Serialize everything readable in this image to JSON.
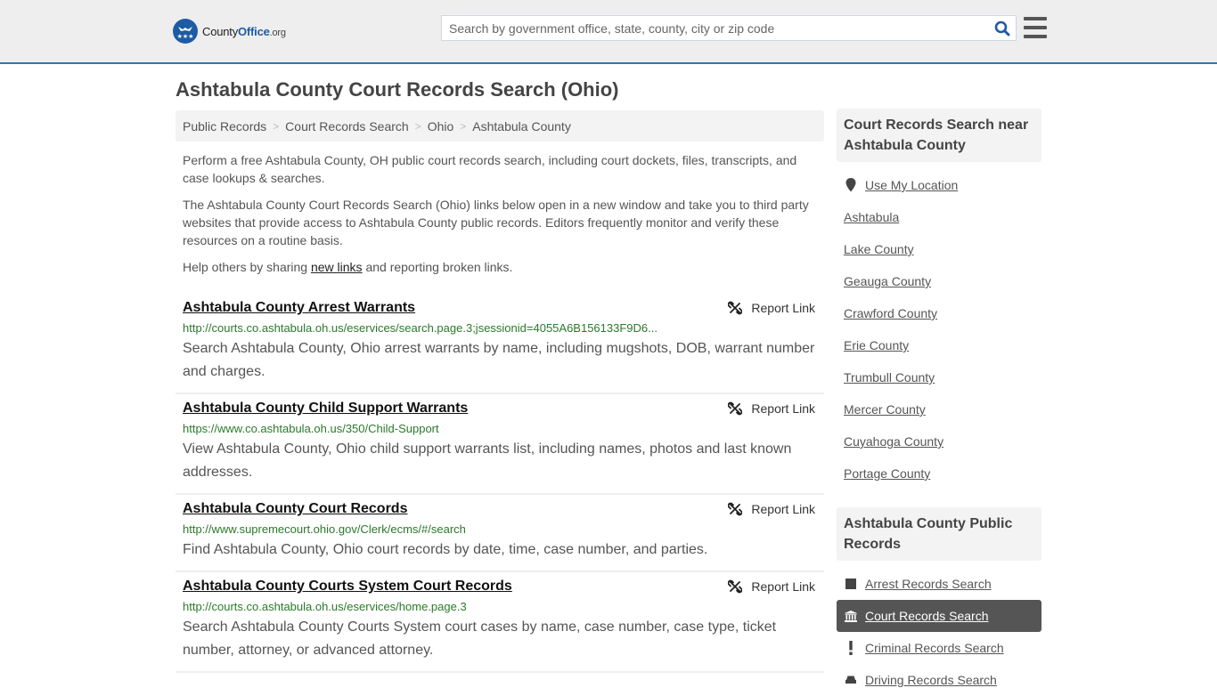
{
  "header": {
    "logo": {
      "prefix": "County",
      "brand": "Office",
      "tld": ".org"
    },
    "search_placeholder": "Search by government office, state, county, city or zip code",
    "search_value": ""
  },
  "page_title": "Ashtabula County Court Records Search (Ohio)",
  "breadcrumb": [
    "Public Records",
    "Court Records Search",
    "Ohio",
    "Ashtabula County"
  ],
  "intro": {
    "p1": "Perform a free Ashtabula County, OH public court records search, including court dockets, files, transcripts, and case lookups & searches.",
    "p2": "The Ashtabula County Court Records Search (Ohio) links below open in a new window and take you to third party websites that provide access to Ashtabula County public records. Editors frequently monitor and verify these resources on a routine basis.",
    "p3_before": "Help others by sharing ",
    "p3_link": "new links",
    "p3_after": " and reporting broken links."
  },
  "report_label": "Report Link",
  "results": [
    {
      "title": "Ashtabula County Arrest Warrants",
      "url": "http://courts.co.ashtabula.oh.us/eservices/search.page.3;jsessionid=4055A6B156133F9D6...",
      "desc": "Search Ashtabula County, Ohio arrest warrants by name, including mugshots, DOB, warrant number and charges."
    },
    {
      "title": "Ashtabula County Child Support Warrants",
      "url": "https://www.co.ashtabula.oh.us/350/Child-Support",
      "desc": "View Ashtabula County, Ohio child support warrants list, including names, photos and last known addresses."
    },
    {
      "title": "Ashtabula County Court Records",
      "url": "http://www.supremecourt.ohio.gov/Clerk/ecms/#/search",
      "desc": "Find Ashtabula County, Ohio court records by date, time, case number, and parties."
    },
    {
      "title": "Ashtabula County Courts System Court Records",
      "url": "http://courts.co.ashtabula.oh.us/eservices/home.page.3",
      "desc": "Search Ashtabula County Courts System court cases by name, case number, case type, ticket number, attorney, or advanced attorney."
    }
  ],
  "sidebar": {
    "nearby_title": "Court Records Search near Ashtabula County",
    "use_location": "Use My Location",
    "nearby": [
      "Ashtabula",
      "Lake County",
      "Geauga County",
      "Crawford County",
      "Erie County",
      "Trumbull County",
      "Mercer County",
      "Cuyahoga County",
      "Portage County"
    ],
    "public_title": "Ashtabula County Public Records",
    "public": [
      {
        "label": "Arrest Records Search",
        "icon": "square-icon",
        "active": false
      },
      {
        "label": "Court Records Search",
        "icon": "courthouse-icon",
        "active": true
      },
      {
        "label": "Criminal Records Search",
        "icon": "exclamation-icon",
        "active": false
      },
      {
        "label": "Driving Records Search",
        "icon": "car-icon",
        "active": false
      }
    ]
  },
  "colors": {
    "accent": "#2f77b1",
    "brand": "#1e5ba5",
    "url_green": "#2a7a2a",
    "active_bg": "#555555"
  }
}
